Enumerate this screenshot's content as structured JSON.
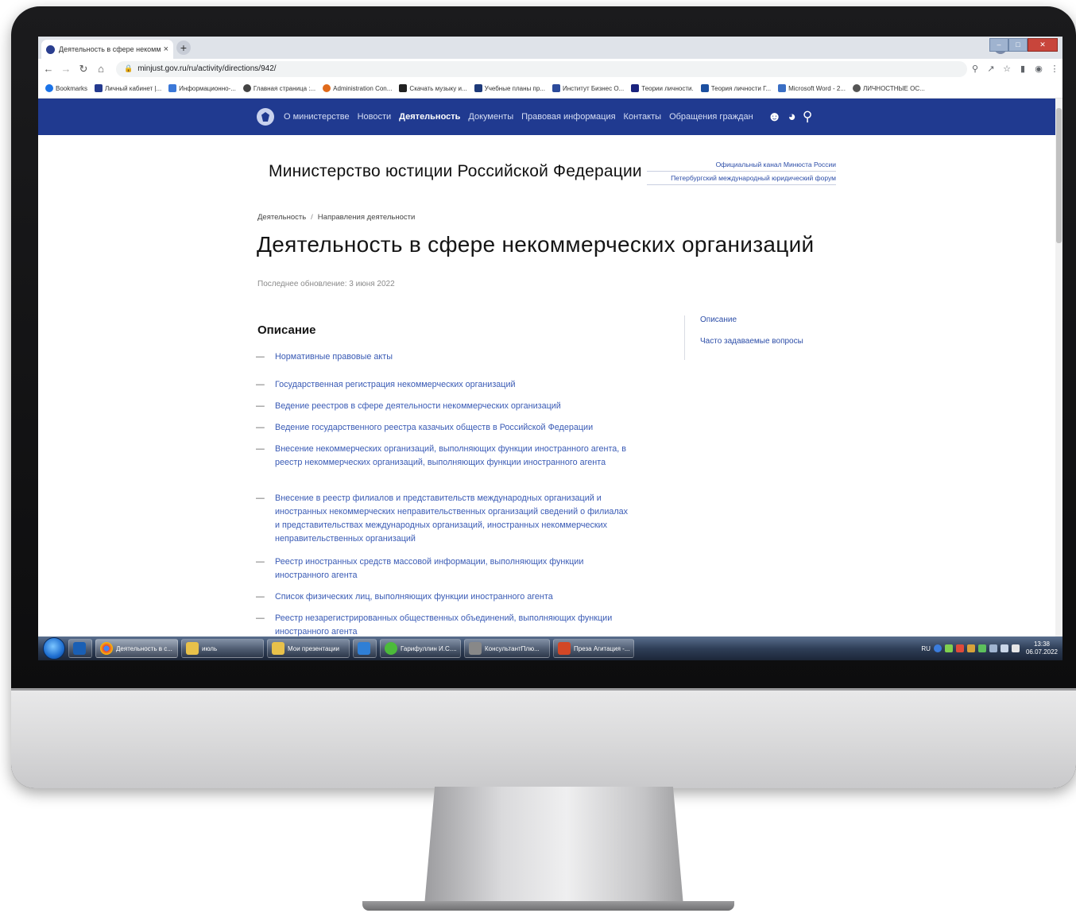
{
  "browser": {
    "tab_title": "Деятельность в сфере некомм",
    "tab_close": "×",
    "new_tab": "+",
    "url": "minjust.gov.ru/ru/activity/directions/942/",
    "bookmarks": [
      "Bookmarks",
      "Личный кабинет |...",
      "Информационно-...",
      "Главная страница :...",
      "Administration Con...",
      "Скачать музыку и...",
      "Учебные планы пр...",
      "Институт Бизнес О...",
      "Теории личности.",
      "Теория личности Г...",
      "Microsoft Word - 2...",
      "ЛИЧНОСТНЫЕ ОС..."
    ]
  },
  "site": {
    "nav": [
      "О министерстве",
      "Новости",
      "Деятельность",
      "Документы",
      "Правовая информация",
      "Контакты",
      "Обращения граждан"
    ],
    "ministry": "Министерство юстиции Российской Федерации",
    "side_links": [
      "Официальный канал Минюста России",
      "Петербургский международный юридический форум"
    ],
    "breadcrumb": [
      "Деятельность",
      "Направления деятельности"
    ],
    "breadcrumb_sep": "/",
    "title": "Деятельность в сфере некоммерческих организаций",
    "updated": "Последнее обновление: 3 июня 2022",
    "section_title": "Описание",
    "toc": [
      "Описание",
      "Часто задаваемые вопросы"
    ],
    "dash": "—",
    "links": [
      "Нормативные правовые акты",
      "Государственная регистрация некоммерческих организаций",
      "Ведение реестров в сфере деятельности некоммерческих организаций",
      "Ведение государственного реестра казачьих обществ в Российской Федерации",
      "Внесение некоммерческих организаций, выполняющих функции иностранного агента, в реестр некоммерческих организаций, выполняющих функции иностранного агента",
      "Внесение в реестр филиалов и представительств международных организаций и иностранных некоммерческих неправительственных организаций сведений о филиалах и представительствах международных организаций, иностранных некоммерческих неправительственных организаций",
      "Реестр иностранных средств массовой информации, выполняющих функции иностранного агента",
      "Список физических лиц, выполняющих функции иностранного агента",
      "Реестр незарегистрированных общественных объединений, выполняющих функции иностранного агента"
    ]
  },
  "taskbar": {
    "items": [
      "Деятельность в с...",
      "июль",
      "Мои презентации",
      "Гарифуллин И.С....",
      "КонсультантПлю...",
      "Преза Агитация -..."
    ],
    "lang": "RU",
    "time": "13:38",
    "date": "06.07.2022"
  },
  "colors": {
    "nav_bg": "#203a90",
    "link": "#3a5bb5"
  }
}
